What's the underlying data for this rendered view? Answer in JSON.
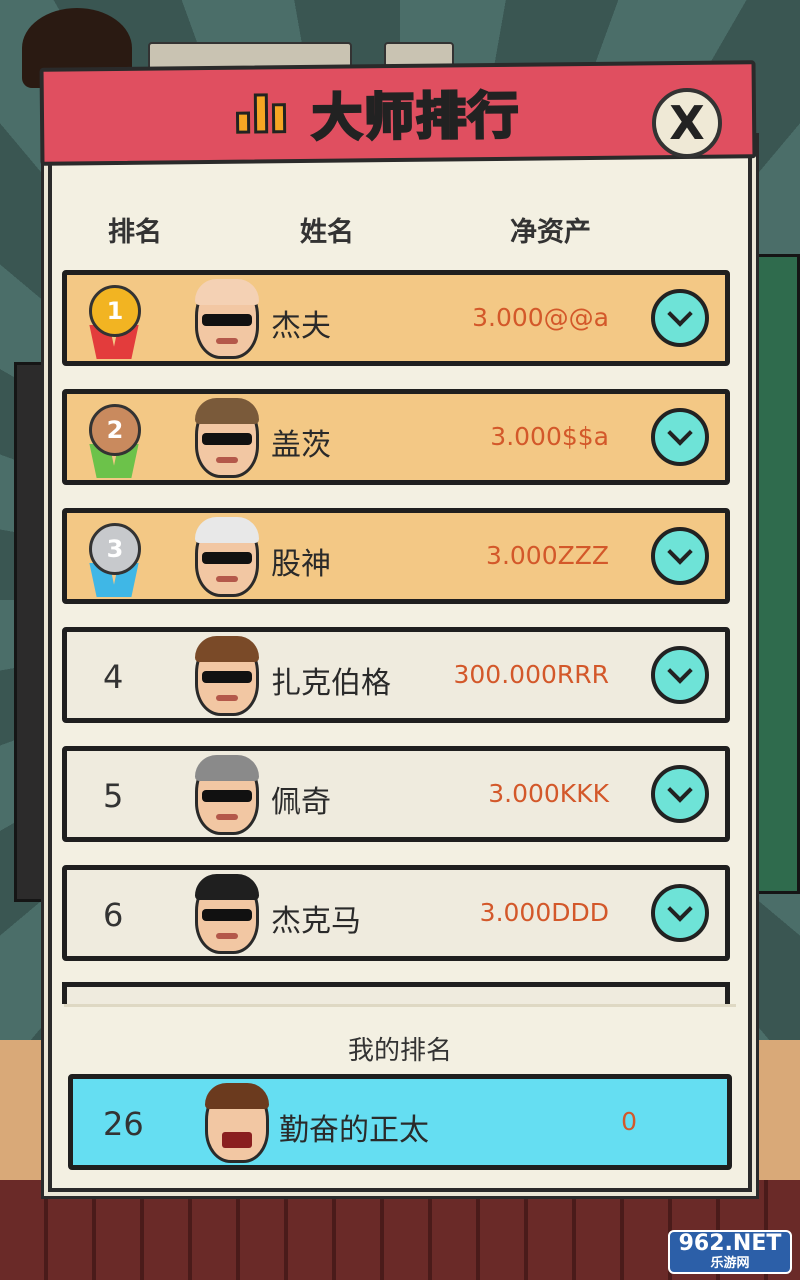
{
  "dialog": {
    "title": "大师排行",
    "close_label": "X"
  },
  "columns": {
    "rank": "排名",
    "name": "姓名",
    "assets": "净资产"
  },
  "entries": [
    {
      "rank": "1",
      "name": "杰夫",
      "assets": "3.000@@a",
      "medal": "gold"
    },
    {
      "rank": "2",
      "name": "盖茨",
      "assets": "3.000$$a",
      "medal": "bronze"
    },
    {
      "rank": "3",
      "name": "股神",
      "assets": "3.000ZZZ",
      "medal": "silver"
    },
    {
      "rank": "4",
      "name": "扎克伯格",
      "assets": "300.000RRR"
    },
    {
      "rank": "5",
      "name": "佩奇",
      "assets": "3.000KKK"
    },
    {
      "rank": "6",
      "name": "杰克马",
      "assets": "3.000DDD"
    }
  ],
  "my_rank": {
    "label": "我的排名",
    "rank": "26",
    "name": "勤奋的正太",
    "assets": "0"
  },
  "watermark": {
    "main": "962.NET",
    "sub": "乐游网"
  },
  "colors": {
    "header": "#e04f60",
    "top_row": "#f3c885",
    "normal_row": "#efebde",
    "my_row": "#65def2",
    "asset_text": "#d3582a",
    "expand_button": "#6ee3d7"
  }
}
